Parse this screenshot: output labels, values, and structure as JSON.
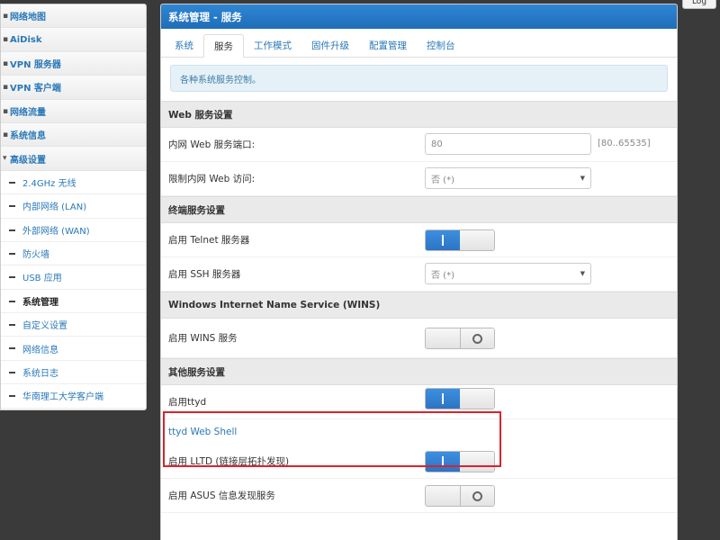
{
  "sidebar": {
    "main_items": [
      {
        "label": "网络地图"
      },
      {
        "label": "AiDisk"
      },
      {
        "label": "VPN 服务器"
      },
      {
        "label": "VPN 客户端"
      },
      {
        "label": "网络流量"
      },
      {
        "label": "系统信息"
      },
      {
        "label": "高级设置"
      }
    ],
    "sub_items": [
      {
        "label": "2.4GHz 无线"
      },
      {
        "label": "内部网络 (LAN)"
      },
      {
        "label": "外部网络 (WAN)"
      },
      {
        "label": "防火墙"
      },
      {
        "label": "USB 应用"
      },
      {
        "label": "系统管理"
      },
      {
        "label": "自定义设置"
      },
      {
        "label": "网络信息"
      },
      {
        "label": "系统日志"
      },
      {
        "label": "华南理工大学客户端"
      }
    ]
  },
  "header": {
    "title": "系统管理 - 服务",
    "log_button": "Log"
  },
  "tabs": [
    {
      "label": "系统"
    },
    {
      "label": "服务"
    },
    {
      "label": "工作模式"
    },
    {
      "label": "固件升级"
    },
    {
      "label": "配置管理"
    },
    {
      "label": "控制台"
    }
  ],
  "info_text": "各种系统服务控制。",
  "web": {
    "title": "Web 服务设置",
    "port_label": "内网 Web 服务端口:",
    "port_value": "80",
    "port_hint": "[80..65535]",
    "limit_label": "限制内网 Web 访问:",
    "limit_value": "否 (*)"
  },
  "terminal": {
    "title": "终端服务设置",
    "telnet_label": "启用 Telnet 服务器",
    "ssh_label": "启用 SSH 服务器",
    "ssh_value": "否 (*)"
  },
  "wins": {
    "title": "Windows Internet Name Service (WINS)",
    "label": "启用 WINS 服务"
  },
  "other": {
    "title": "其他服务设置",
    "ttyd_label": "启用ttyd",
    "ttyd_link": "ttyd Web Shell",
    "lltd_label": "启用 LLTD (链接层拓扑发现)",
    "asus_label": "启用 ASUS 信息发现服务"
  },
  "toggles": {
    "telnet": "on",
    "wins": "off",
    "ttyd": "on",
    "lltd": "on",
    "asus": "off"
  },
  "colors": {
    "accent": "#2a78b8",
    "header": "#2478c8",
    "highlight": "#d9232c"
  }
}
